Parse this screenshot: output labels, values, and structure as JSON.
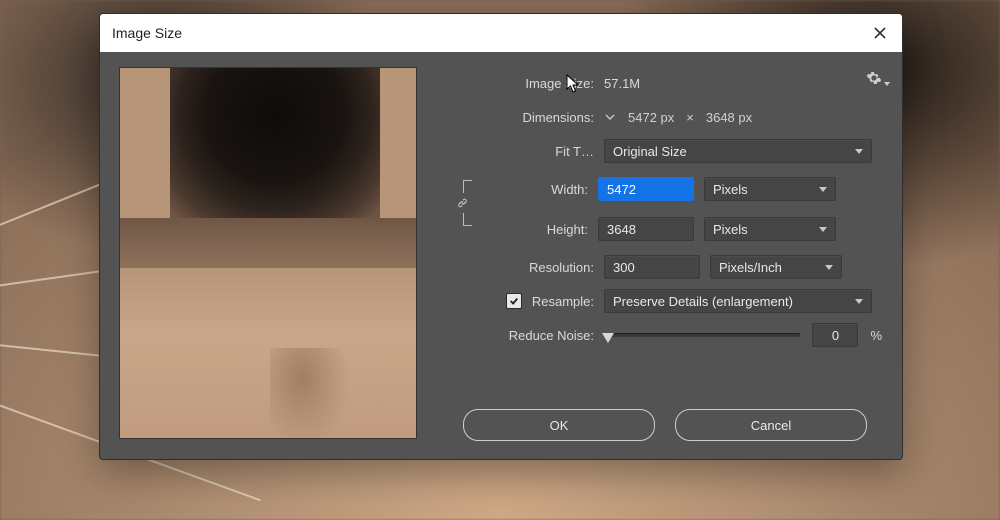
{
  "dialog": {
    "title": "Image Size",
    "labels": {
      "image_size": "Image Size:",
      "dimensions": "Dimensions:",
      "fit_to": "Fit T…",
      "width": "Width:",
      "height": "Height:",
      "resolution": "Resolution:",
      "resample": "Resample:",
      "reduce_noise": "Reduce Noise:"
    },
    "values": {
      "image_size": "57.1M",
      "dim_w": "5472 px",
      "dim_sep": "×",
      "dim_h": "3648 px",
      "fit_to": "Original Size",
      "width": "5472",
      "height": "3648",
      "resolution": "300",
      "width_unit": "Pixels",
      "height_unit": "Pixels",
      "resolution_unit": "Pixels/Inch",
      "resample_method": "Preserve Details (enlargement)",
      "reduce_noise": "0",
      "reduce_noise_suffix": "%"
    },
    "resample_checked": true,
    "buttons": {
      "ok": "OK",
      "cancel": "Cancel"
    }
  }
}
